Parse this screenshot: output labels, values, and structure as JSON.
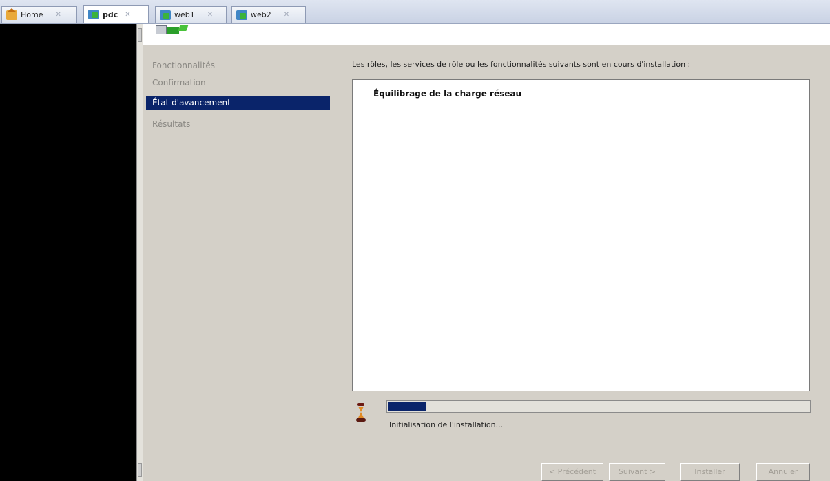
{
  "tabs": [
    {
      "label": "Home",
      "icon": "home-icon",
      "active": false
    },
    {
      "label": "pdc",
      "icon": "vm-icon",
      "active": true
    },
    {
      "label": "web1",
      "icon": "vm-icon",
      "active": false
    },
    {
      "label": "web2",
      "icon": "vm-icon",
      "active": false
    }
  ],
  "tab_close_glyph": "✕",
  "nav": {
    "items": [
      {
        "label": "Fonctionnalités",
        "active": false
      },
      {
        "label": "Confirmation",
        "active": false
      },
      {
        "label": "État d'avancement",
        "active": true
      },
      {
        "label": "Résultats",
        "active": false
      }
    ]
  },
  "content": {
    "description": "Les rôles, les services de rôle ou les fonctionnalités suivants sont en cours d'installation :",
    "list_items": [
      "Équilibrage de la charge réseau"
    ],
    "progress_fraction": 0.09,
    "status_text": "Initialisation de l'installation..."
  },
  "buttons": {
    "previous": "< Précédent",
    "next": "Suivant >",
    "install": "Installer",
    "cancel": "Annuler"
  },
  "colors": {
    "selection": "#0a246a",
    "progress": "#0a246a",
    "window_bg": "#d4d0c8"
  }
}
